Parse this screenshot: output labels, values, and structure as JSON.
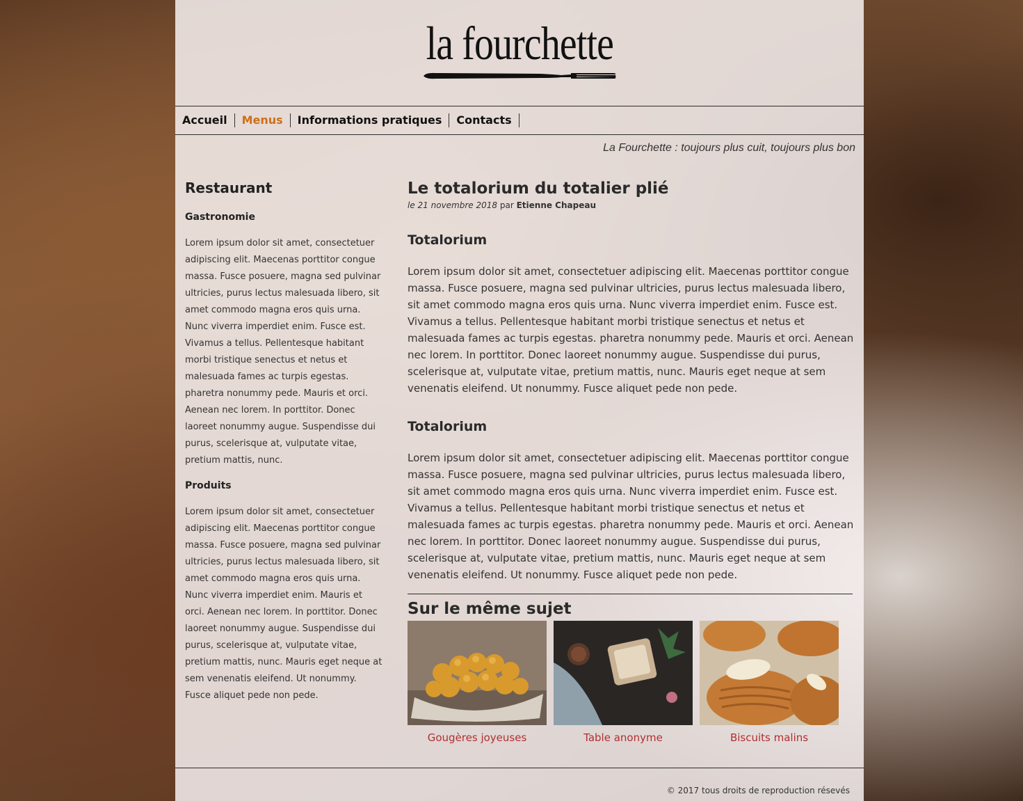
{
  "header": {
    "logo_text": "la fourchette",
    "tagline": "La Fourchette : toujours plus cuit, toujours plus bon"
  },
  "nav": {
    "items": [
      {
        "label": "Accueil"
      },
      {
        "label": "Menus",
        "active": true
      },
      {
        "label": "Informations pratiques"
      },
      {
        "label": "Contacts"
      }
    ]
  },
  "sidebar": {
    "title": "Restaurant",
    "sections": [
      {
        "heading": "Gastronomie",
        "text": "Lorem ipsum dolor sit amet, consectetuer adipiscing elit. Maecenas porttitor congue massa. Fusce posuere, magna sed pulvinar ultricies, purus lectus malesuada libero, sit amet commodo magna eros quis urna. Nunc viverra imperdiet enim. Fusce est. Vivamus a tellus. Pellentesque habitant morbi tristique senectus et netus et malesuada fames ac turpis egestas. pharetra nonummy pede. Mauris et orci. Aenean nec lorem. In porttitor. Donec laoreet nonummy augue. Suspendisse dui purus, scelerisque at, vulputate vitae, pretium mattis, nunc."
      },
      {
        "heading": "Produits",
        "text": "Lorem ipsum dolor sit amet, consectetuer adipiscing elit. Maecenas porttitor congue massa. Fusce posuere, magna sed pulvinar ultricies, purus lectus malesuada libero, sit amet commodo magna eros quis urna. Nunc viverra imperdiet enim. Mauris et orci. Aenean nec lorem. In porttitor. Donec laoreet nonummy augue. Suspendisse dui purus, scelerisque at, vulputate vitae, pretium mattis, nunc. Mauris eget neque at sem venenatis eleifend. Ut nonummy. Fusce aliquet pede non pede."
      }
    ]
  },
  "article": {
    "title": "Le totalorium du totalier plié",
    "date": "le 21 novembre 2018",
    "by_word": "par",
    "author": "Etienne Chapeau",
    "sections": [
      {
        "heading": "Totalorium",
        "text": "Lorem ipsum dolor sit amet, consectetuer adipiscing elit. Maecenas porttitor congue massa. Fusce posuere, magna sed pulvinar ultricies, purus lectus malesuada libero, sit amet commodo magna eros quis urna. Nunc viverra imperdiet enim. Fusce est. Vivamus a tellus. Pellentesque habitant morbi tristique senectus et netus et malesuada fames ac turpis egestas. pharetra nonummy pede. Mauris et orci. Aenean nec lorem. In porttitor. Donec laoreet nonummy augue. Suspendisse dui purus, scelerisque at, vulputate vitae, pretium mattis, nunc. Mauris eget neque at sem venenatis eleifend. Ut nonummy. Fusce aliquet pede non pede."
      },
      {
        "heading": "Totalorium",
        "text": "Lorem ipsum dolor sit amet, consectetuer adipiscing elit. Maecenas porttitor congue massa. Fusce posuere, magna sed pulvinar ultricies, purus lectus malesuada libero, sit amet commodo magna eros quis urna. Nunc viverra imperdiet enim. Fusce est. Vivamus a tellus. Pellentesque habitant morbi tristique senectus et netus et malesuada fames ac turpis egestas. pharetra nonummy pede. Mauris et orci. Aenean nec lorem. In porttitor. Donec laoreet nonummy augue. Suspendisse dui purus, scelerisque at, vulputate vitae, pretium mattis, nunc. Mauris eget neque at sem venenatis eleifend. Ut nonummy. Fusce aliquet pede non pede."
      }
    ]
  },
  "related": {
    "title": "Sur le même sujet",
    "items": [
      {
        "caption": "Gougères joyeuses"
      },
      {
        "caption": "Table anonyme"
      },
      {
        "caption": "Biscuits malins"
      }
    ]
  },
  "footer": {
    "copyright": "© 2017 tous droits de reproduction résevés"
  },
  "colors": {
    "accent": "#cf6f18",
    "link": "#b03030"
  }
}
